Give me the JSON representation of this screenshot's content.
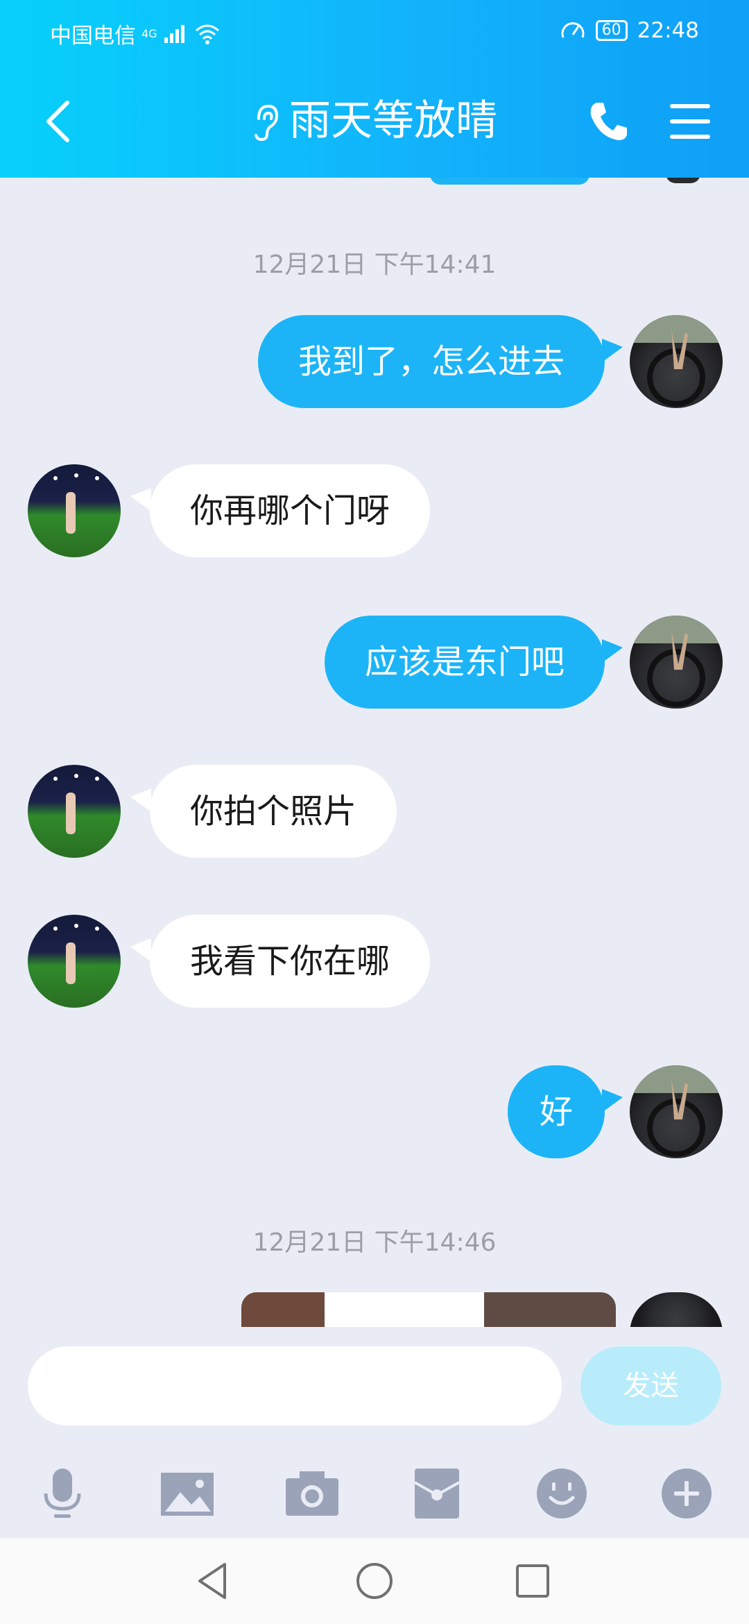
{
  "status_bar": {
    "carrier": "中国电信",
    "network": "4G",
    "battery": "60",
    "time": "22:48"
  },
  "header": {
    "title": "雨天等放晴"
  },
  "messages": [
    {
      "type": "timestamp",
      "text": "12月21日 下午14:41"
    },
    {
      "type": "sent",
      "text": "我到了，怎么进去"
    },
    {
      "type": "received",
      "text": "你再哪个门呀"
    },
    {
      "type": "sent",
      "text": "应该是东门吧"
    },
    {
      "type": "received",
      "text": "你拍个照片"
    },
    {
      "type": "received",
      "text": "我看下你在哪"
    },
    {
      "type": "sent",
      "text": "好"
    },
    {
      "type": "timestamp",
      "text": "12月21日 下午14:46"
    },
    {
      "type": "sent-image",
      "text": ""
    }
  ],
  "composer": {
    "input_value": "",
    "send_label": "发送"
  },
  "toolbar_icons": [
    "microphone-icon",
    "image-icon",
    "camera-icon",
    "red-packet-icon",
    "emoji-icon",
    "plus-icon"
  ],
  "nav_icons": [
    "back-nav-icon",
    "home-nav-icon",
    "recents-nav-icon"
  ],
  "colors": {
    "header_start": "#07d1fb",
    "header_end": "#0f9ff7",
    "sent_bubble": "#1cb4f7",
    "received_bubble": "#ffffff",
    "chat_background": "#e9ecf5",
    "send_button": "#b8ecfb",
    "toolbar_icon": "#9aa3b8"
  }
}
